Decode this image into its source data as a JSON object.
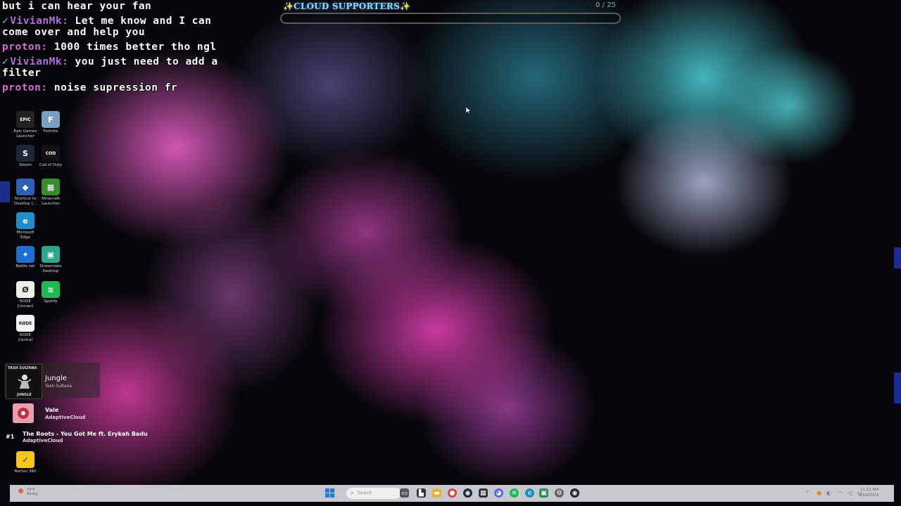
{
  "chat": {
    "lines": [
      {
        "badge": "",
        "user": "",
        "text": "but i can hear your fan"
      },
      {
        "badge": "✓",
        "user": "VivianMk:",
        "text": "Let me know and I can come over and help you"
      },
      {
        "badge": "",
        "user": "proton:",
        "text": "1000 times better tho ngl"
      },
      {
        "badge": "✓",
        "user": "VivianMk:",
        "text": "you just need to add a filter"
      },
      {
        "badge": "",
        "user": "proton:",
        "text": "noise supression fr"
      }
    ]
  },
  "goal": {
    "title": "✨CLOUD SUPPORTERS✨",
    "count": "0 / 25",
    "progress": 0
  },
  "desktop_icons": [
    {
      "label": "Epic Games Launcher",
      "icon": "epic-games-icon",
      "glyph": "EPIC",
      "color": "#222222"
    },
    {
      "label": "Fortnite",
      "icon": "fortnite-icon",
      "glyph": "F",
      "color": "#7a9fc0"
    },
    {
      "label": "Steam",
      "icon": "steam-icon",
      "glyph": "S",
      "color": "#1b2838"
    },
    {
      "label": "Call of Duty",
      "icon": "call-of-duty-icon",
      "glyph": "COD",
      "color": "#111111"
    },
    {
      "label": "Shortcut to Desktop (...",
      "icon": "shortcut-icon",
      "glyph": "◆",
      "color": "#2b5fb8"
    },
    {
      "label": "Minecraft Launcher",
      "icon": "minecraft-icon",
      "glyph": "▦",
      "color": "#3c8a2e"
    },
    {
      "label": "Microsoft Edge",
      "icon": "edge-icon",
      "glyph": "e",
      "color": "#1f8fc9"
    },
    {
      "label": "Battle.net",
      "icon": "battlenet-icon",
      "glyph": "✦",
      "color": "#1d6fd0"
    },
    {
      "label": "Streamlabs Desktop",
      "icon": "streamlabs-icon",
      "glyph": "▣",
      "color": "#2ea58c"
    },
    {
      "label": "RODE Connect",
      "icon": "rode-connect-icon",
      "glyph": "Ø",
      "color": "#ececec"
    },
    {
      "label": "Spotify",
      "icon": "spotify-icon",
      "glyph": "≋",
      "color": "#1db954"
    },
    {
      "label": "RODE Central",
      "icon": "rode-central-icon",
      "glyph": "RØDE",
      "color": "#f2f2f2"
    },
    {
      "label": "Norton 360",
      "icon": "norton-icon",
      "glyph": "✓",
      "color": "#f5c518"
    }
  ],
  "now_playing": {
    "art_top": "TASH SULTANA",
    "art_bottom": "JUNGLE",
    "title": "Jungle",
    "artist": "Tash Sultana"
  },
  "queue": [
    {
      "rank": "",
      "title": "Vale",
      "artist": "AdaptiveCloud"
    },
    {
      "rank": "#1",
      "title": "The Roots - You Got Me ft. Erykah Badu",
      "artist": "AdaptiveCloud"
    }
  ],
  "taskbar": {
    "weather_temp": "73°F",
    "weather_desc": "Sunny",
    "search_placeholder": "Search",
    "time": "11:11 AM",
    "date": "9/10/2023"
  }
}
